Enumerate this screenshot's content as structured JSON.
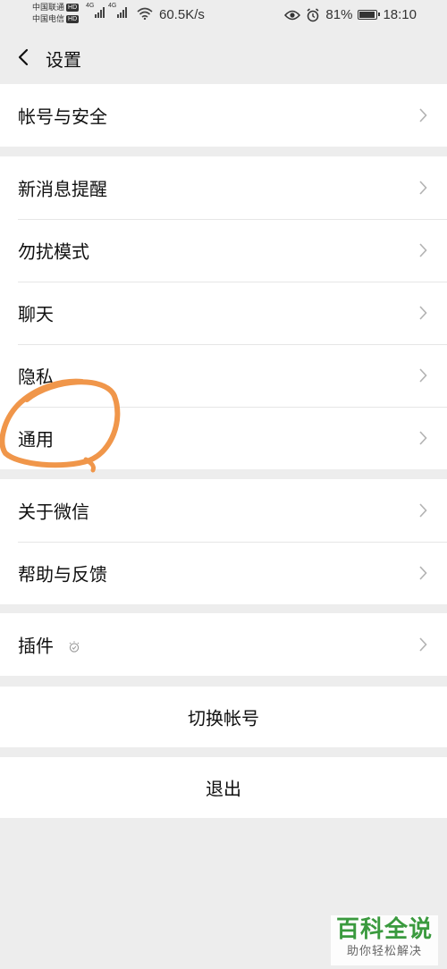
{
  "status_bar": {
    "carrier1": "中国联通",
    "carrier2": "中国电信",
    "hd_badge": "HD",
    "network": "4G",
    "speed": "60.5K/s",
    "battery": "81%",
    "time": "18:10",
    "battery_level": 0.81
  },
  "header": {
    "title": "设置"
  },
  "groups": {
    "account": [
      {
        "label": "帐号与安全"
      }
    ],
    "main": [
      {
        "label": "新消息提醒"
      },
      {
        "label": "勿扰模式"
      },
      {
        "label": "聊天"
      },
      {
        "label": "隐私"
      },
      {
        "label": "通用"
      }
    ],
    "about": [
      {
        "label": "关于微信"
      },
      {
        "label": "帮助与反馈"
      }
    ],
    "plugins": [
      {
        "label": "插件"
      }
    ]
  },
  "actions": {
    "switch_account": "切换帐号",
    "logout": "退出"
  },
  "watermark": {
    "title": "百科全说",
    "subtitle": "助你轻松解决"
  },
  "colors": {
    "background": "#ededed",
    "annotation": "#f0964a",
    "watermark_green": "#3a9a3e"
  }
}
